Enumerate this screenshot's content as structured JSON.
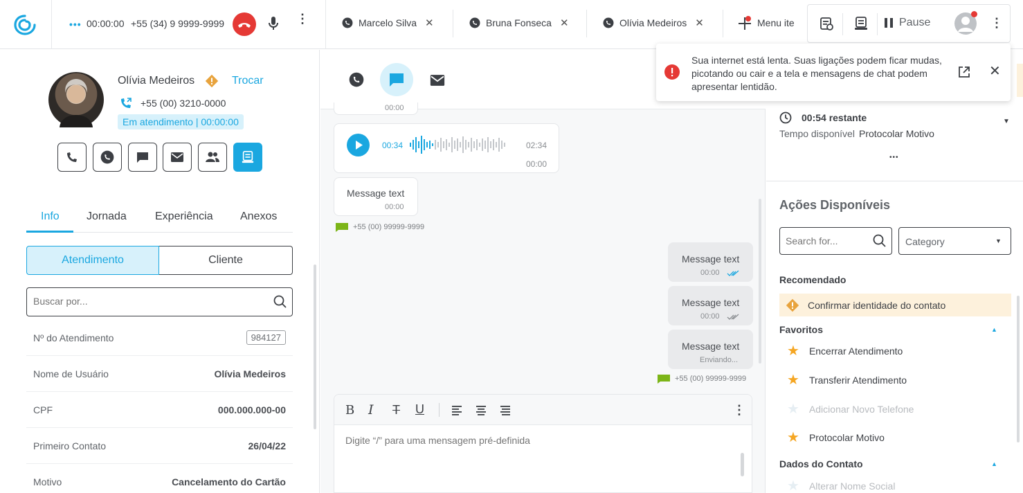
{
  "call": {
    "timer": "00:00:00",
    "phone": "+55 (34) 9 9999-9999"
  },
  "tabs": [
    {
      "name": "Marcelo Silva"
    },
    {
      "name": "Bruna Fonseca"
    },
    {
      "name": "Olívia Medeiros"
    }
  ],
  "menu_item": "Menu ite",
  "pause_label": "Pause",
  "contact": {
    "name": "Olívia Medeiros",
    "swap": "Trocar",
    "phone": "+55 (00) 3210-0000",
    "status": "Em atendimento | 00:00:00"
  },
  "info_tabs": [
    "Info",
    "Jornada",
    "Experiência",
    "Anexos"
  ],
  "segment": {
    "a": "Atendimento",
    "b": "Cliente"
  },
  "search_placeholder": "Buscar por...",
  "fields": [
    {
      "k": "Nº do Atendimento",
      "v": "984127"
    },
    {
      "k": "Nome de Usuário",
      "v": "Olívia Medeiros"
    },
    {
      "k": "CPF",
      "v": "000.000.000-00"
    },
    {
      "k": "Primeiro Contato",
      "v": "26/04/22"
    },
    {
      "k": "Motivo",
      "v": "Cancelamento do Cartão"
    }
  ],
  "chat": {
    "top_time": "00:00",
    "audio": {
      "elapsed": "00:34",
      "total": "02:34",
      "time": "00:00"
    },
    "msg_in": {
      "text": "Message text",
      "time": "00:00"
    },
    "sender_in": "+55 (00) 99999-9999",
    "out": [
      {
        "text": "Message text",
        "time": "00:00"
      },
      {
        "text": "Message text",
        "time": "00:00"
      },
      {
        "text": "Message text",
        "time": "Enviando..."
      }
    ],
    "sender_out": "+55 (00) 99999-9999",
    "composer_placeholder": "Digite “/” para uma mensagem pré-definida"
  },
  "alert": "Sua internet está lenta. Suas ligações podem ficar mudas, picotando ou cair e a tela e mensagens de chat podem apresentar lentidão.",
  "timer_panel": {
    "remaining": "00:54 restante",
    "label": "Tempo disponível",
    "target": "Protocolar Motivo",
    "more": "•••"
  },
  "actions": {
    "title": "Ações Disponíveis",
    "search_placeholder": "Search for...",
    "category": "Category",
    "recommended_title": "Recomendado",
    "recommended": "Confirmar identidade do contato",
    "favorites_title": "Favoritos",
    "favorites": [
      {
        "label": "Encerrar Atendimento"
      },
      {
        "label": "Transferir Atendimento"
      },
      {
        "label": "Adicionar Novo Telefone"
      },
      {
        "label": "Protocolar Motivo"
      }
    ],
    "contact_title": "Dados do Contato",
    "contact_items": [
      {
        "label": "Alterar Nome Social"
      }
    ]
  },
  "colors": {
    "accent": "#1aa7e0",
    "danger": "#e53935",
    "warning": "#e8a33d",
    "green": "#7cb518"
  }
}
